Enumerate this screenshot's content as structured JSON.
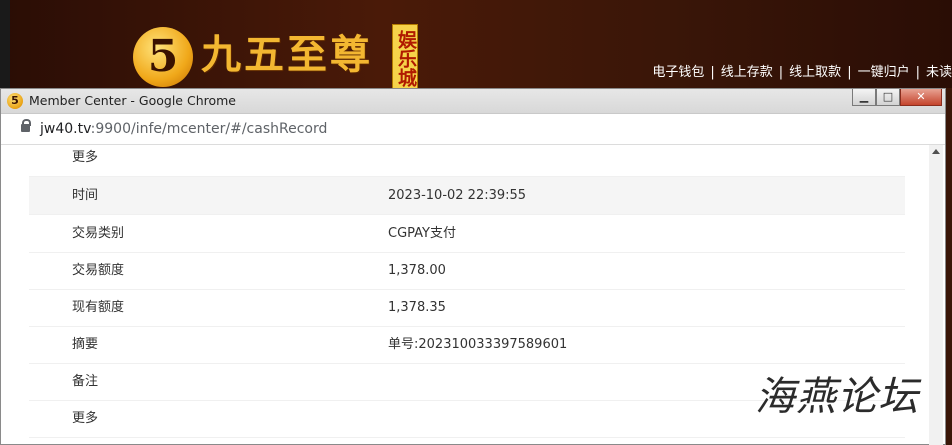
{
  "site": {
    "logo_glyph": "5",
    "logo_text": "九五至尊",
    "logo_badge": "娱乐城",
    "nav": [
      "电子钱包",
      "线上存款",
      "线上取款",
      "一键归户",
      "未读"
    ]
  },
  "window": {
    "title": "Member Center - Google Chrome",
    "minimize_glyph": "▁",
    "maximize_glyph": "□",
    "close_glyph": "✕"
  },
  "address": {
    "host": "jw40.tv",
    "rest": ":9900/infe/mcenter/#/cashRecord"
  },
  "rows": [
    {
      "label": "更多",
      "value": "",
      "shaded": false
    },
    {
      "label": "时间",
      "value": "2023-10-02 22:39:55",
      "shaded": true
    },
    {
      "label": "交易类别",
      "value": "CGPAY支付",
      "shaded": false
    },
    {
      "label": "交易额度",
      "value": "1,378.00",
      "shaded": false
    },
    {
      "label": "现有额度",
      "value": "1,378.35",
      "shaded": false
    },
    {
      "label": "摘要",
      "value": "单号:202310033397589601",
      "shaded": false
    },
    {
      "label": "备注",
      "value": "",
      "shaded": false
    },
    {
      "label": "更多",
      "value": "",
      "shaded": false
    }
  ],
  "watermark": "海燕论坛"
}
